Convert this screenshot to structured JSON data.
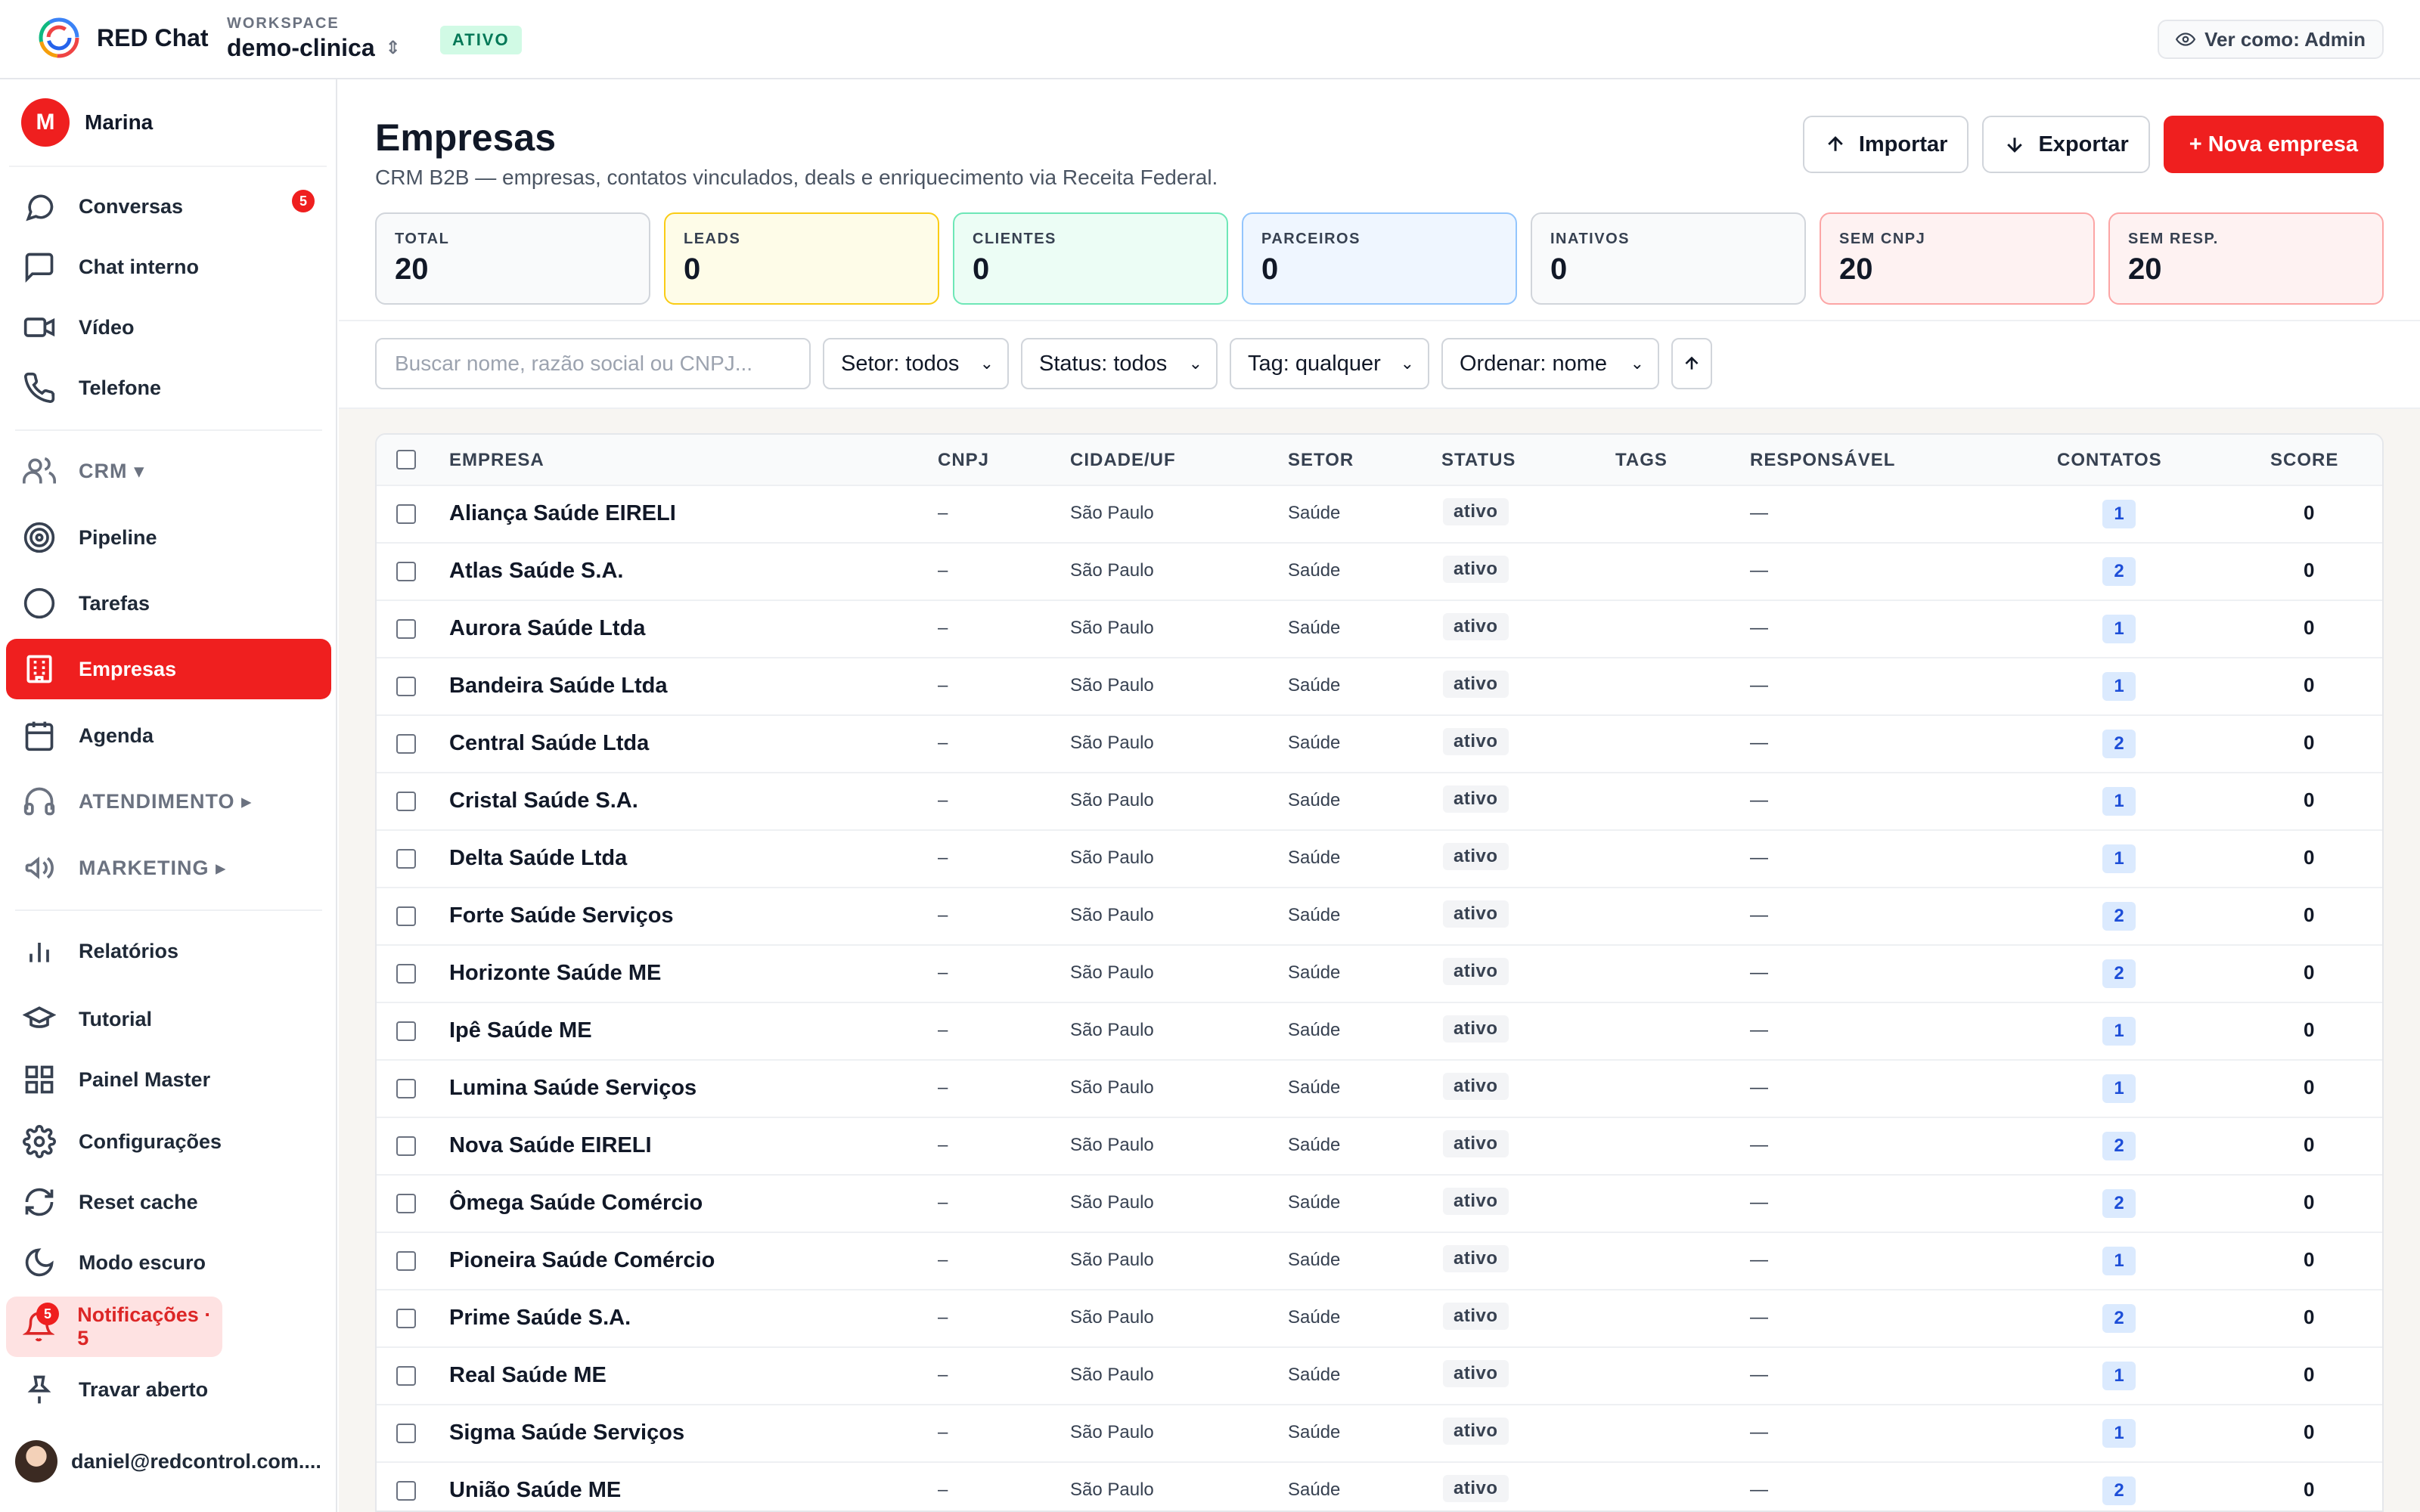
{
  "topbar": {
    "brand": "RED Chat",
    "workspace_label": "WORKSPACE",
    "workspace_name": "demo-clinica",
    "workspace_status": "ATIVO",
    "view_as": "Ver como: Admin"
  },
  "sidebar": {
    "user": {
      "initial": "M",
      "name": "Marina"
    },
    "items": [
      {
        "label": "Conversas",
        "icon": "chat-bubble-icon",
        "badge": "5"
      },
      {
        "label": "Chat interno",
        "icon": "message-square-icon"
      },
      {
        "label": "Vídeo",
        "icon": "video-icon"
      },
      {
        "label": "Telefone",
        "icon": "phone-icon"
      },
      {
        "label": "CRM ▾",
        "icon": "users-icon"
      },
      {
        "label": "Pipeline",
        "icon": "target-icon"
      },
      {
        "label": "Tarefas",
        "icon": "circle-icon"
      },
      {
        "label": "Empresas",
        "icon": "building-icon"
      },
      {
        "label": "Agenda",
        "icon": "calendar-icon"
      },
      {
        "label": "ATENDIMENTO ▸",
        "icon": "headphones-icon"
      },
      {
        "label": "MARKETING ▸",
        "icon": "megaphone-icon"
      },
      {
        "label": "Relatórios",
        "icon": "bar-chart-icon"
      },
      {
        "label": "Tutorial",
        "icon": "graduation-cap-icon"
      },
      {
        "label": "Painel Master",
        "icon": "grid-icon"
      },
      {
        "label": "Configurações",
        "icon": "gear-icon"
      },
      {
        "label": "Reset cache",
        "icon": "refresh-icon"
      },
      {
        "label": "Modo escuro",
        "icon": "moon-icon"
      },
      {
        "label": "Notificações · 5",
        "icon": "bell-icon",
        "badge": "5"
      },
      {
        "label": "Travar aberto",
        "icon": "pin-icon"
      }
    ],
    "footer_email": "daniel@redcontrol.com...."
  },
  "main": {
    "title": "Empresas",
    "subtitle": "CRM B2B — empresas, contatos vinculados, deals e enriquecimento via Receita Federal.",
    "actions": {
      "import": "Importar",
      "export": "Exportar",
      "new": "+ Nova empresa"
    },
    "stats": [
      {
        "label": "TOTAL",
        "value": "20"
      },
      {
        "label": "LEADS",
        "value": "0"
      },
      {
        "label": "CLIENTES",
        "value": "0"
      },
      {
        "label": "PARCEIROS",
        "value": "0"
      },
      {
        "label": "INATIVOS",
        "value": "0"
      },
      {
        "label": "SEM CNPJ",
        "value": "20"
      },
      {
        "label": "SEM RESP.",
        "value": "20"
      }
    ],
    "filters": {
      "search_placeholder": "Buscar nome, razão social ou CNPJ...",
      "setor": "Setor: todos",
      "status": "Status: todos",
      "tag": "Tag: qualquer",
      "order": "Ordenar: nome"
    },
    "table": {
      "columns": [
        "EMPRESA",
        "CNPJ",
        "CIDADE/UF",
        "SETOR",
        "STATUS",
        "TAGS",
        "RESPONSÁVEL",
        "CONTATOS",
        "SCORE"
      ],
      "rows": [
        {
          "empresa": "Aliança Saúde EIRELI",
          "cnpj": "–",
          "cidade": "São Paulo",
          "setor": "Saúde",
          "status": "ativo",
          "responsavel": "—",
          "contatos": "1",
          "score": "0"
        },
        {
          "empresa": "Atlas Saúde S.A.",
          "cnpj": "–",
          "cidade": "São Paulo",
          "setor": "Saúde",
          "status": "ativo",
          "responsavel": "—",
          "contatos": "2",
          "score": "0"
        },
        {
          "empresa": "Aurora Saúde Ltda",
          "cnpj": "–",
          "cidade": "São Paulo",
          "setor": "Saúde",
          "status": "ativo",
          "responsavel": "—",
          "contatos": "1",
          "score": "0"
        },
        {
          "empresa": "Bandeira Saúde Ltda",
          "cnpj": "–",
          "cidade": "São Paulo",
          "setor": "Saúde",
          "status": "ativo",
          "responsavel": "—",
          "contatos": "1",
          "score": "0"
        },
        {
          "empresa": "Central Saúde Ltda",
          "cnpj": "–",
          "cidade": "São Paulo",
          "setor": "Saúde",
          "status": "ativo",
          "responsavel": "—",
          "contatos": "2",
          "score": "0"
        },
        {
          "empresa": "Cristal Saúde S.A.",
          "cnpj": "–",
          "cidade": "São Paulo",
          "setor": "Saúde",
          "status": "ativo",
          "responsavel": "—",
          "contatos": "1",
          "score": "0"
        },
        {
          "empresa": "Delta Saúde Ltda",
          "cnpj": "–",
          "cidade": "São Paulo",
          "setor": "Saúde",
          "status": "ativo",
          "responsavel": "—",
          "contatos": "1",
          "score": "0"
        },
        {
          "empresa": "Forte Saúde Serviços",
          "cnpj": "–",
          "cidade": "São Paulo",
          "setor": "Saúde",
          "status": "ativo",
          "responsavel": "—",
          "contatos": "2",
          "score": "0"
        },
        {
          "empresa": "Horizonte Saúde ME",
          "cnpj": "–",
          "cidade": "São Paulo",
          "setor": "Saúde",
          "status": "ativo",
          "responsavel": "—",
          "contatos": "2",
          "score": "0"
        },
        {
          "empresa": "Ipê Saúde ME",
          "cnpj": "–",
          "cidade": "São Paulo",
          "setor": "Saúde",
          "status": "ativo",
          "responsavel": "—",
          "contatos": "1",
          "score": "0"
        },
        {
          "empresa": "Lumina Saúde Serviços",
          "cnpj": "–",
          "cidade": "São Paulo",
          "setor": "Saúde",
          "status": "ativo",
          "responsavel": "—",
          "contatos": "1",
          "score": "0"
        },
        {
          "empresa": "Nova Saúde EIRELI",
          "cnpj": "–",
          "cidade": "São Paulo",
          "setor": "Saúde",
          "status": "ativo",
          "responsavel": "—",
          "contatos": "2",
          "score": "0"
        },
        {
          "empresa": "Ômega Saúde Comércio",
          "cnpj": "–",
          "cidade": "São Paulo",
          "setor": "Saúde",
          "status": "ativo",
          "responsavel": "—",
          "contatos": "2",
          "score": "0"
        },
        {
          "empresa": "Pioneira Saúde Comércio",
          "cnpj": "–",
          "cidade": "São Paulo",
          "setor": "Saúde",
          "status": "ativo",
          "responsavel": "—",
          "contatos": "1",
          "score": "0"
        },
        {
          "empresa": "Prime Saúde S.A.",
          "cnpj": "–",
          "cidade": "São Paulo",
          "setor": "Saúde",
          "status": "ativo",
          "responsavel": "—",
          "contatos": "2",
          "score": "0"
        },
        {
          "empresa": "Real Saúde ME",
          "cnpj": "–",
          "cidade": "São Paulo",
          "setor": "Saúde",
          "status": "ativo",
          "responsavel": "—",
          "contatos": "1",
          "score": "0"
        },
        {
          "empresa": "Sigma Saúde Serviços",
          "cnpj": "–",
          "cidade": "São Paulo",
          "setor": "Saúde",
          "status": "ativo",
          "responsavel": "—",
          "contatos": "1",
          "score": "0"
        },
        {
          "empresa": "União Saúde ME",
          "cnpj": "–",
          "cidade": "São Paulo",
          "setor": "Saúde",
          "status": "ativo",
          "responsavel": "—",
          "contatos": "2",
          "score": "0"
        }
      ]
    }
  },
  "colors": {
    "accent": "#ef1f1f",
    "active_badge": "#d1fae5",
    "chip": "#dbeafe"
  }
}
